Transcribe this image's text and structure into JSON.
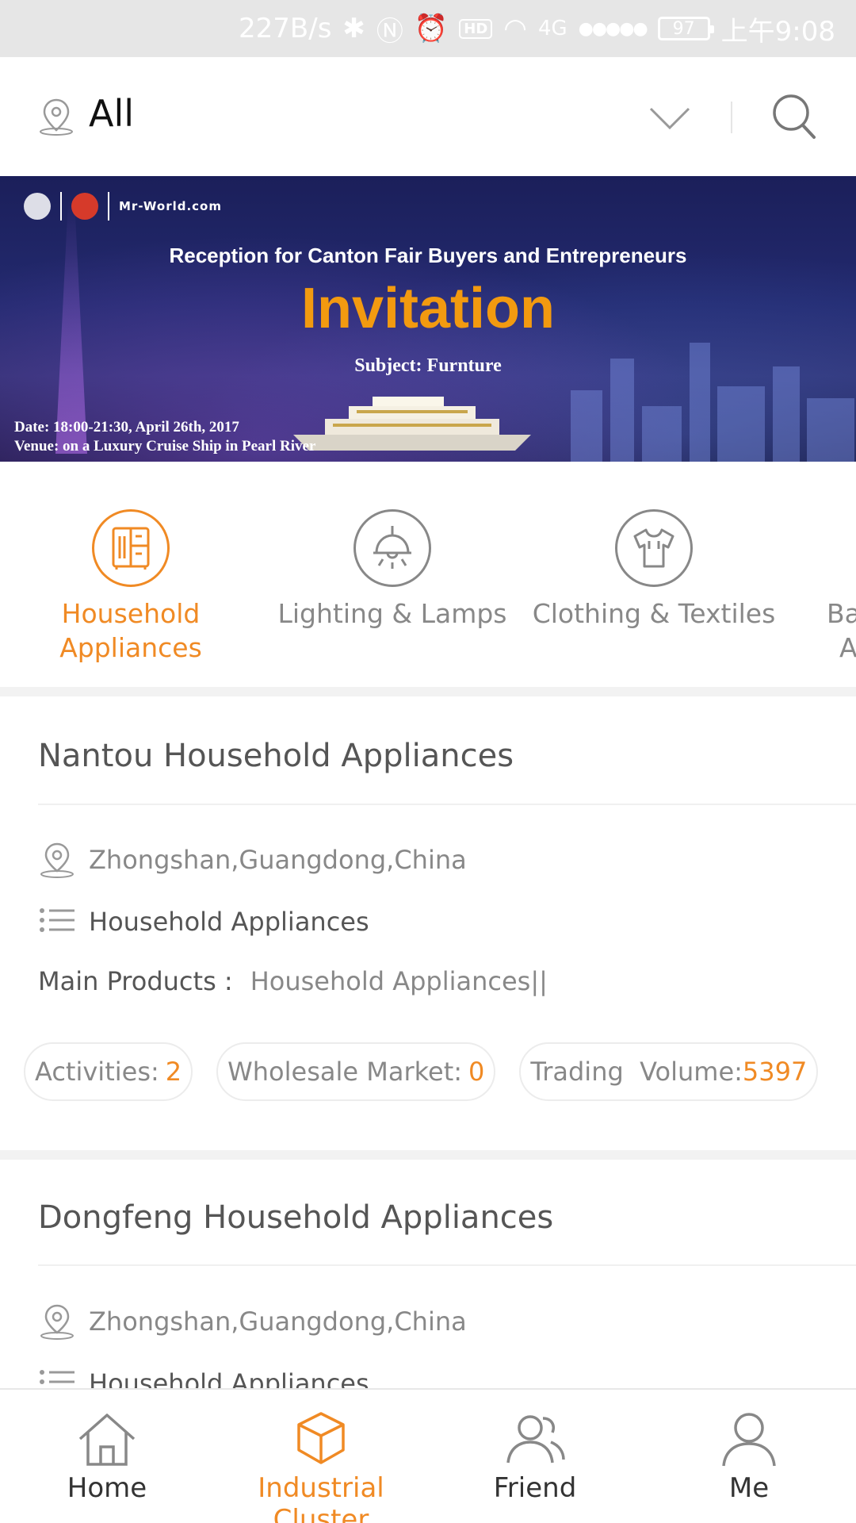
{
  "status_bar": {
    "net_speed": "227B/s",
    "network": "4G",
    "signal": "●●●●●",
    "battery": "97",
    "time": "上午9:08",
    "hd": "HD"
  },
  "header": {
    "location_label": "All"
  },
  "banner": {
    "logo_text": "Mr-World.com",
    "headline": "Reception for Canton Fair Buyers and Entrepreneurs",
    "title": "Invitation",
    "subject": "Subject: Furnture",
    "date": "Date: 18:00-21:30, April 26th, 2017",
    "venue": "Venue: on a Luxury Cruise Ship in Pearl River"
  },
  "categories": [
    {
      "label_line1": "Household",
      "label_line2": "Appliances",
      "icon": "refrigerator-icon",
      "active": true
    },
    {
      "label_line1": "Lighting & Lamps",
      "label_line2": "",
      "icon": "lamp-icon",
      "active": false
    },
    {
      "label_line1": "Clothing & Textiles",
      "label_line2": "",
      "icon": "shirt-icon",
      "active": false
    },
    {
      "label_line1": "Ba",
      "label_line2": "A",
      "icon": "category-icon",
      "active": false
    }
  ],
  "clusters": [
    {
      "name": "Nantou Household Appliances",
      "location": "Zhongshan,Guangdong,China",
      "category": "Household Appliances",
      "main_products_label": "Main Products :",
      "main_products": "Household Appliances||",
      "activities_label": "Activities:",
      "activities": "2",
      "wholesale_label": "Wholesale Market:",
      "wholesale": "0",
      "trading_label": "Trading  Volume:",
      "trading": "5397"
    },
    {
      "name": "Dongfeng Household Appliances",
      "location": "Zhongshan,Guangdong,China",
      "category": "Household Appliances"
    }
  ],
  "bottom_nav": [
    {
      "label": "Home",
      "icon": "home-icon",
      "active": false
    },
    {
      "label": "Industrial Cluster",
      "icon": "cube-icon",
      "active": true
    },
    {
      "label": "Friend",
      "icon": "friends-icon",
      "active": false
    },
    {
      "label": "Me",
      "icon": "user-icon",
      "active": false
    }
  ],
  "colors": {
    "accent": "#f08a24",
    "muted": "#888888",
    "banner_bg": "#232a6f",
    "invitation": "#f29a10"
  }
}
